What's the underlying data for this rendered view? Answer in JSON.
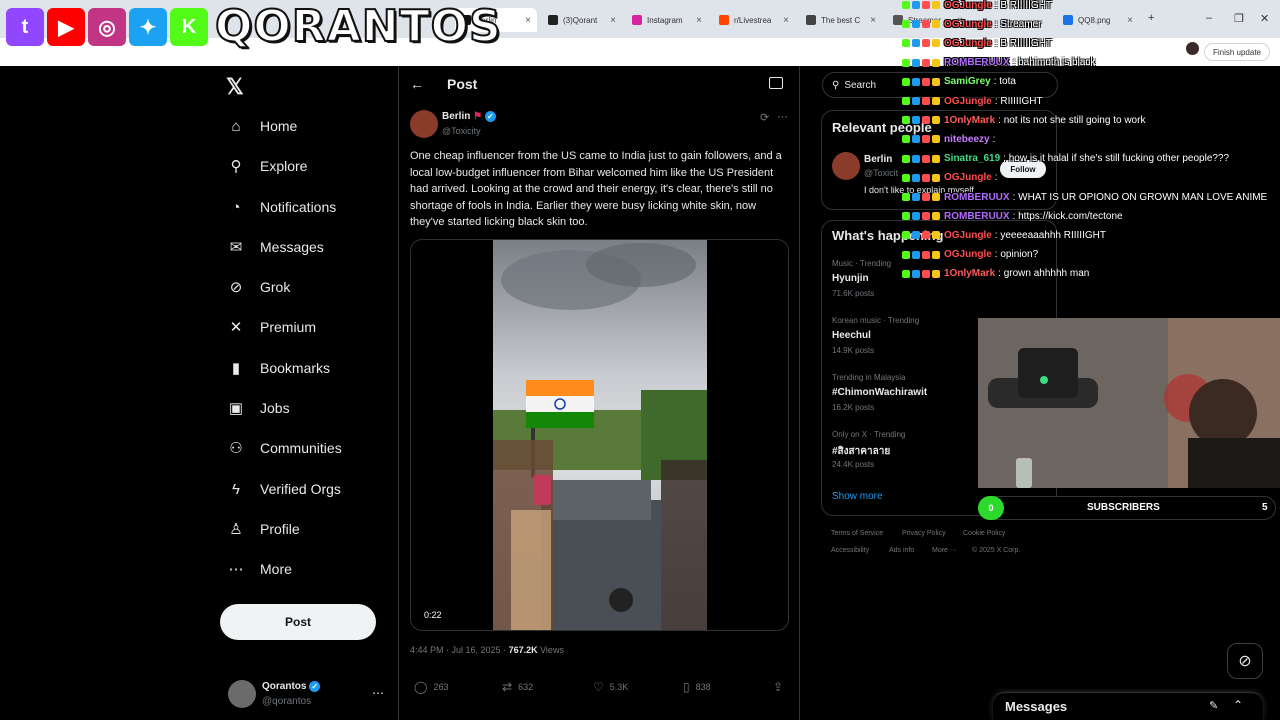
{
  "browser": {
    "tabs": [
      {
        "label": "Berlin",
        "fav_color": "#111111",
        "active": true
      },
      {
        "label": "(3)Qorant",
        "fav_color": "#222222",
        "active": false
      },
      {
        "label": "Instagram",
        "fav_color": "#d6249f",
        "active": false
      },
      {
        "label": "r/Livestrea",
        "fav_color": "#ff4500",
        "active": false
      },
      {
        "label": "The best C",
        "fav_color": "#444444",
        "active": false
      },
      {
        "label": "Streamer",
        "fav_color": "#555555",
        "active": false
      },
      {
        "label": "QQ8.png",
        "fav_color": "#1a73e8",
        "active": false
      }
    ],
    "update_label": "Finish update"
  },
  "overlay": {
    "brand": "QORANTOS",
    "logos": [
      {
        "name": "twitch",
        "glyph": "t",
        "color": "#9146ff"
      },
      {
        "name": "youtube",
        "glyph": "▶",
        "color": "#ff0000"
      },
      {
        "name": "instagram",
        "glyph": "◎",
        "color": "#c13584"
      },
      {
        "name": "twitter",
        "glyph": "✦",
        "color": "#1da1f2"
      },
      {
        "name": "kick",
        "glyph": "K",
        "color": "#53fc18"
      }
    ],
    "subscribers_label": "SUBSCRIBERS",
    "subscribers_count": "0",
    "subscribers_goal": "5"
  },
  "nav": {
    "logo": "𝕏",
    "items": [
      {
        "label": "Home",
        "icon": "home-icon",
        "glyph": "⌂"
      },
      {
        "label": "Explore",
        "icon": "search-icon",
        "glyph": "⚲"
      },
      {
        "label": "Notifications",
        "icon": "bell-icon",
        "glyph": "◔"
      },
      {
        "label": "Messages",
        "icon": "mail-icon",
        "glyph": "✉"
      },
      {
        "label": "Grok",
        "icon": "grok-icon",
        "glyph": "⊘"
      },
      {
        "label": "Premium",
        "icon": "x-icon",
        "glyph": "✕"
      },
      {
        "label": "Bookmarks",
        "icon": "bookmark-icon",
        "glyph": "▮"
      },
      {
        "label": "Jobs",
        "icon": "briefcase-icon",
        "glyph": "▣"
      },
      {
        "label": "Communities",
        "icon": "people-icon",
        "glyph": "⚇"
      },
      {
        "label": "Verified Orgs",
        "icon": "lightning-icon",
        "glyph": "ϟ"
      },
      {
        "label": "Profile",
        "icon": "profile-icon",
        "glyph": "♙"
      },
      {
        "label": "More",
        "icon": "more-icon",
        "glyph": "⋯"
      }
    ],
    "post_label": "Post",
    "account": {
      "name": "Qorantos",
      "handle": "@qorantos"
    }
  },
  "post": {
    "header": "Post",
    "author": "Berlin",
    "handle": "@Toxicity",
    "text": "One cheap influencer from the US came to India just to gain followers, and a local low-budget influencer from Bihar welcomed him like the US President had arrived. Looking at the crowd and their energy, it's clear, there's still no shortage of fools in India. Earlier they were busy licking white skin, now they've started licking black skin too.",
    "video_time": "0:22",
    "timestamp": "4:44 PM · Jul 16, 2025 · ",
    "views_count": "767.2K",
    "views_label": " Views",
    "metrics": {
      "replies": "263",
      "reposts": "632",
      "likes": "5.3K",
      "bookmarks": "838"
    }
  },
  "right": {
    "search_placeholder": "Search",
    "relevant_title": "Relevant people",
    "relevant_person": {
      "name": "Berlin",
      "handle": "@Toxicit",
      "bio": "I don't like to explain myself.",
      "follow_label": "Follow"
    },
    "happening_title": "What's happening",
    "trends": [
      {
        "category": "Music · Trending",
        "name": "Hyunjin",
        "count": "71.6K posts"
      },
      {
        "category": "Korean music · Trending",
        "name": "Heechul",
        "count": "14.9K posts"
      },
      {
        "category": "Trending in Malaysia",
        "name": "#ChimonWachirawit",
        "count": "16.2K posts"
      },
      {
        "category": "Only on X · Trending",
        "name": "#สิงสาคาลาย",
        "count": "24.4K posts"
      }
    ],
    "show_more": "Show more",
    "footer": [
      "Terms of Service",
      "Privacy Policy",
      "Cookie Policy",
      "Accessibility",
      "Ads info",
      "More ···",
      "© 2025 X Corp."
    ]
  },
  "chat": [
    {
      "user": "OGJungle",
      "color": "#ff4d4d",
      "msg": "B RIIIIIGHT"
    },
    {
      "user": "OGJungle",
      "color": "#ff4d4d",
      "msg": "Streamer"
    },
    {
      "user": "OGJungle",
      "color": "#ff4d4d",
      "msg": "B RIIIIIGHT"
    },
    {
      "user": "ROMBERUUX",
      "color": "#b36bff",
      "msg": "bahimoth is black"
    },
    {
      "user": "SamiGrey",
      "color": "#7cff6b",
      "msg": "tota"
    },
    {
      "user": "OGJungle",
      "color": "#ff4d4d",
      "msg": "RIIIIIGHT"
    },
    {
      "user": "1OnlyMark",
      "color": "#ff5c5c",
      "msg": "not its not she still going to work"
    },
    {
      "user": "nitebeezy",
      "color": "#c77dff",
      "msg": ""
    },
    {
      "user": "Sinatra_619",
      "color": "#3ddc84",
      "msg": "how is it halal if she's still fucking other people???"
    },
    {
      "user": "OGJungle",
      "color": "#ff4d4d",
      "msg": ""
    },
    {
      "user": "ROMBERUUX",
      "color": "#b36bff",
      "msg": "WHAT IS UR OPIONO ON GROWN MAN LOVE ANIME"
    },
    {
      "user": "ROMBERUUX",
      "color": "#b36bff",
      "msg": "https://kick.com/tectone"
    },
    {
      "user": "OGJungle",
      "color": "#ff4d4d",
      "msg": "yeeeeaaahhh RIIIIIGHT"
    },
    {
      "user": "OGJungle",
      "color": "#ff4d4d",
      "msg": "opinion?"
    },
    {
      "user": "1OnlyMark",
      "color": "#ff5c5c",
      "msg": "grown ahhhhh man"
    }
  ],
  "messages_drawer": {
    "label": "Messages"
  },
  "colors": {
    "accent": "#1d9bf0",
    "background": "#000000",
    "border": "#2f3336",
    "muted": "#71767b"
  }
}
